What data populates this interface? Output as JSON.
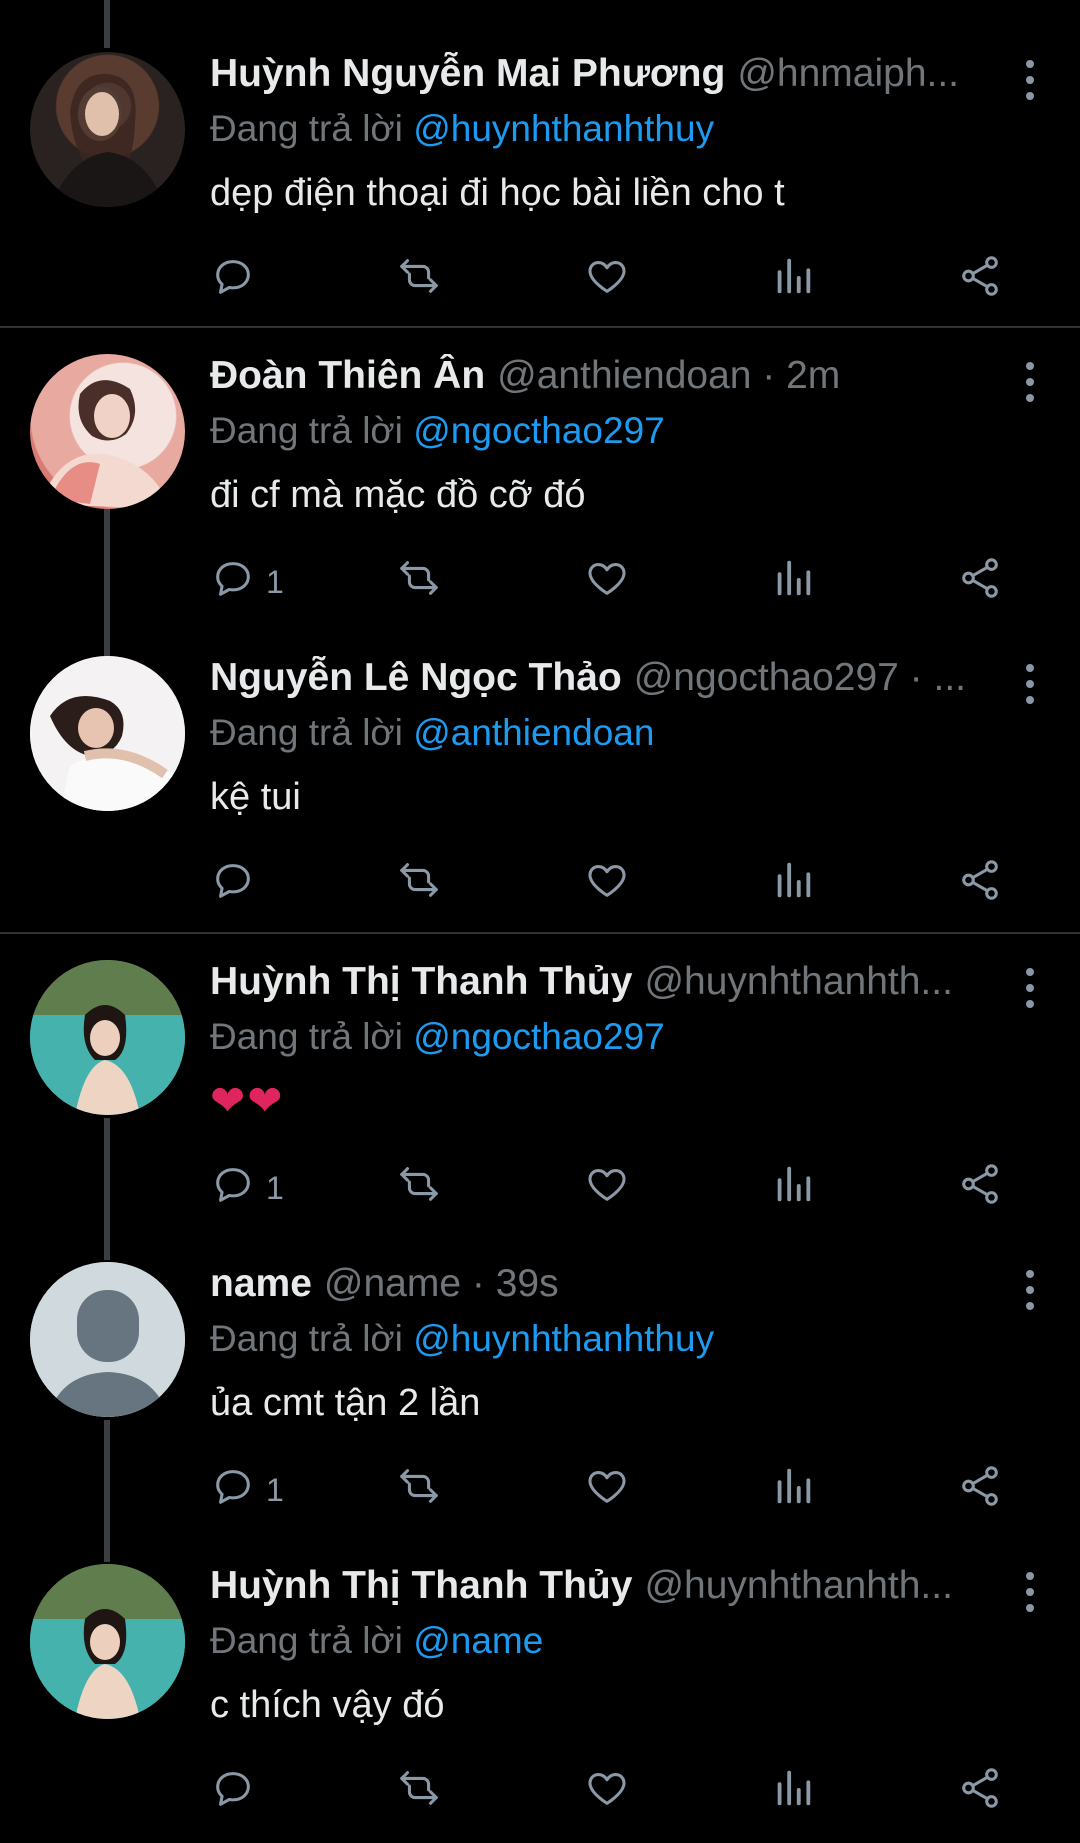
{
  "tweets": [
    {
      "name": "Huỳnh Nguyễn Mai Phương",
      "handle": "@hnmaiph...",
      "reply_prefix": "Đang trả lời ",
      "reply_to": "@huynhthanhthuy",
      "text": "dẹp điện thoại đi học bài liền cho t",
      "reply_count": ""
    },
    {
      "name": "Đoàn Thiên Ân",
      "handle": "@anthiendoan · 2m",
      "reply_prefix": "Đang trả lời ",
      "reply_to": "@ngocthao297",
      "text": "đi cf mà mặc đồ cỡ đó",
      "reply_count": "1"
    },
    {
      "name": "Nguyễn Lê Ngọc Thảo",
      "handle": "@ngocthao297 · ...",
      "reply_prefix": "Đang trả lời ",
      "reply_to": "@anthiendoan",
      "text": "kệ tui",
      "reply_count": ""
    },
    {
      "name": "Huỳnh Thị Thanh Thủy",
      "handle": "@huynhthanhth...",
      "reply_prefix": "Đang trả lời ",
      "reply_to": "@ngocthao297",
      "text": "❤❤",
      "reply_count": "1"
    },
    {
      "name": "name",
      "handle": "@name · 39s",
      "reply_prefix": "Đang trả lời ",
      "reply_to": "@huynhthanhthuy",
      "text": "ủa cmt tận 2 lần",
      "reply_count": "1"
    },
    {
      "name": "Huỳnh Thị Thanh Thủy",
      "handle": "@huynhthanhth...",
      "reply_prefix": "Đang trả lời ",
      "reply_to": "@name",
      "text": "c thích vậy đó",
      "reply_count": ""
    }
  ],
  "icons": {
    "reply": "reply-icon",
    "retweet": "retweet-icon",
    "like": "heart-icon",
    "views": "views-icon",
    "share": "share-icon",
    "more": "more-options-icon"
  },
  "colors": {
    "background": "#000000",
    "mention": "#1d9bf0",
    "muted": "#71767b",
    "text": "#e7e9ea",
    "heart": "#e0245e"
  }
}
